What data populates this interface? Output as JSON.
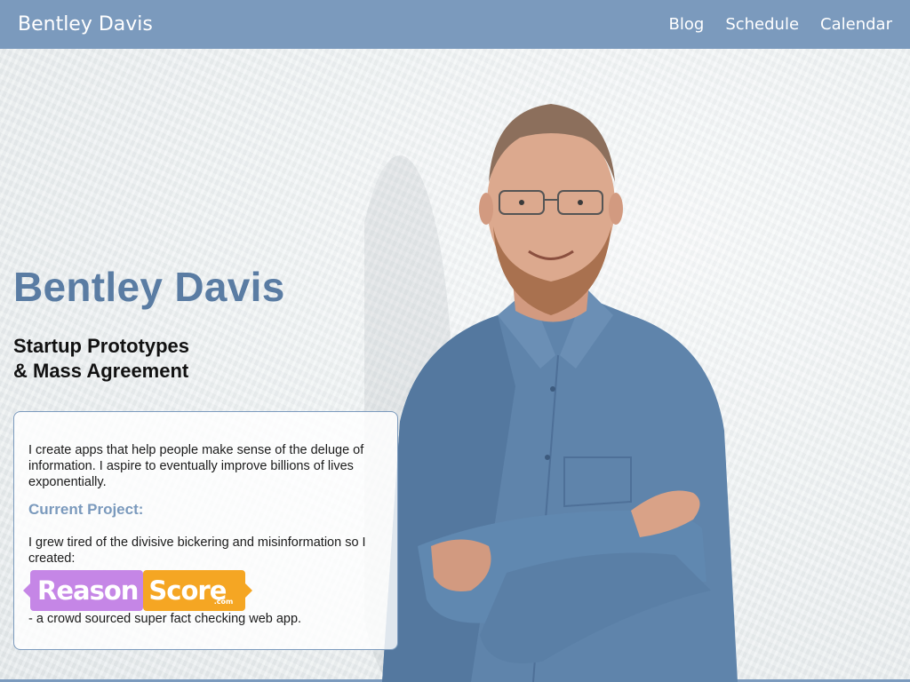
{
  "nav": {
    "brand": "Bentley Davis",
    "links": [
      "Blog",
      "Schedule",
      "Calendar"
    ]
  },
  "hero": {
    "title": "Bentley Davis",
    "tagline_line1": "Startup Prototypes",
    "tagline_line2": "& Mass Agreement"
  },
  "card": {
    "intro": "I create apps that help people make sense of the deluge of information. I aspire to eventually improve billions of lives exponentially.",
    "heading": "Current Project:",
    "lead": "I grew tired of the divisive bickering and misinformation so I created:",
    "logo": {
      "part1": "Reason",
      "part2": "Score",
      "suffix": ".com"
    },
    "tail": "- a crowd sourced super fact checking web app."
  },
  "colors": {
    "navbar": "#7b9abd",
    "title": "#5a7ca3",
    "heading": "#7b9abd",
    "logo_purple": "#c586e6",
    "logo_orange": "#f5a623",
    "shirt": "#5f84ab"
  },
  "images": {
    "portrait": "portrait-photo of smiling man with glasses and beard, arms crossed, blue shirt"
  }
}
